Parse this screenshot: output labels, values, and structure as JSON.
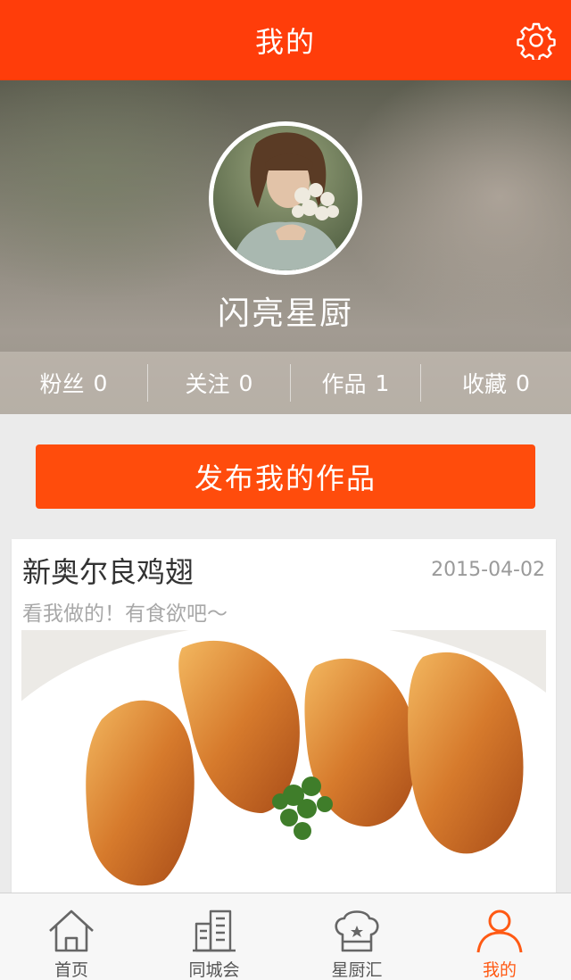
{
  "header": {
    "title": "我的",
    "settings_icon": "gear-icon"
  },
  "profile": {
    "username": "闪亮星厨",
    "stats": [
      {
        "label": "粉丝",
        "value": "0"
      },
      {
        "label": "关注",
        "value": "0"
      },
      {
        "label": "作品",
        "value": "1"
      },
      {
        "label": "收藏",
        "value": "0"
      }
    ]
  },
  "publish_button": {
    "label": "发布我的作品"
  },
  "post": {
    "title": "新奥尔良鸡翅",
    "date": "2015-04-02",
    "description": "看我做的！有食欲吧～"
  },
  "tabbar": {
    "items": [
      {
        "label": "首页",
        "icon": "home-icon"
      },
      {
        "label": "同城会",
        "icon": "buildings-icon"
      },
      {
        "label": "星厨汇",
        "icon": "chef-hat-icon"
      },
      {
        "label": "我的",
        "icon": "person-icon",
        "active": true
      }
    ],
    "active_color": "#ff5a14"
  },
  "colors": {
    "accent": "#ff3d0a",
    "button": "#ff4c0c"
  }
}
